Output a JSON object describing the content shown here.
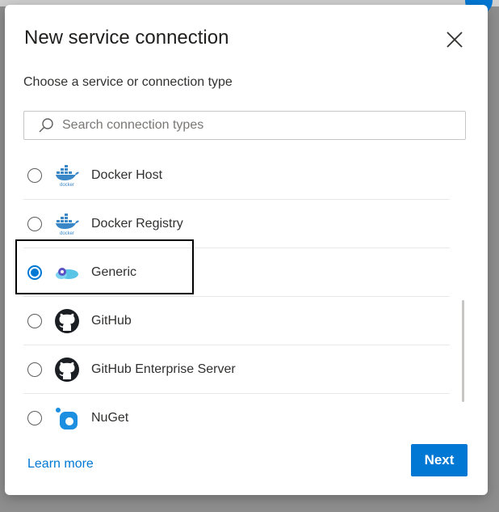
{
  "dialog": {
    "title": "New service connection",
    "subtitle": "Choose a service or connection type",
    "close_icon": "close-icon"
  },
  "search": {
    "placeholder": "Search connection types",
    "value": "",
    "icon": "search-icon"
  },
  "connection_types": [
    {
      "label": "Docker Host",
      "icon": "docker-icon",
      "selected": false
    },
    {
      "label": "Docker Registry",
      "icon": "docker-icon",
      "selected": false
    },
    {
      "label": "Generic",
      "icon": "cloud-icon",
      "selected": true
    },
    {
      "label": "GitHub",
      "icon": "github-icon",
      "selected": false
    },
    {
      "label": "GitHub Enterprise Server",
      "icon": "github-icon",
      "selected": false
    },
    {
      "label": "NuGet",
      "icon": "nuget-icon",
      "selected": false
    }
  ],
  "docker_logo_text": "docker",
  "footer": {
    "learn_more": "Learn more",
    "next_label": "Next"
  },
  "colors": {
    "accent": "#0078d4",
    "text": "#323130",
    "selection_outline": "#000000"
  }
}
